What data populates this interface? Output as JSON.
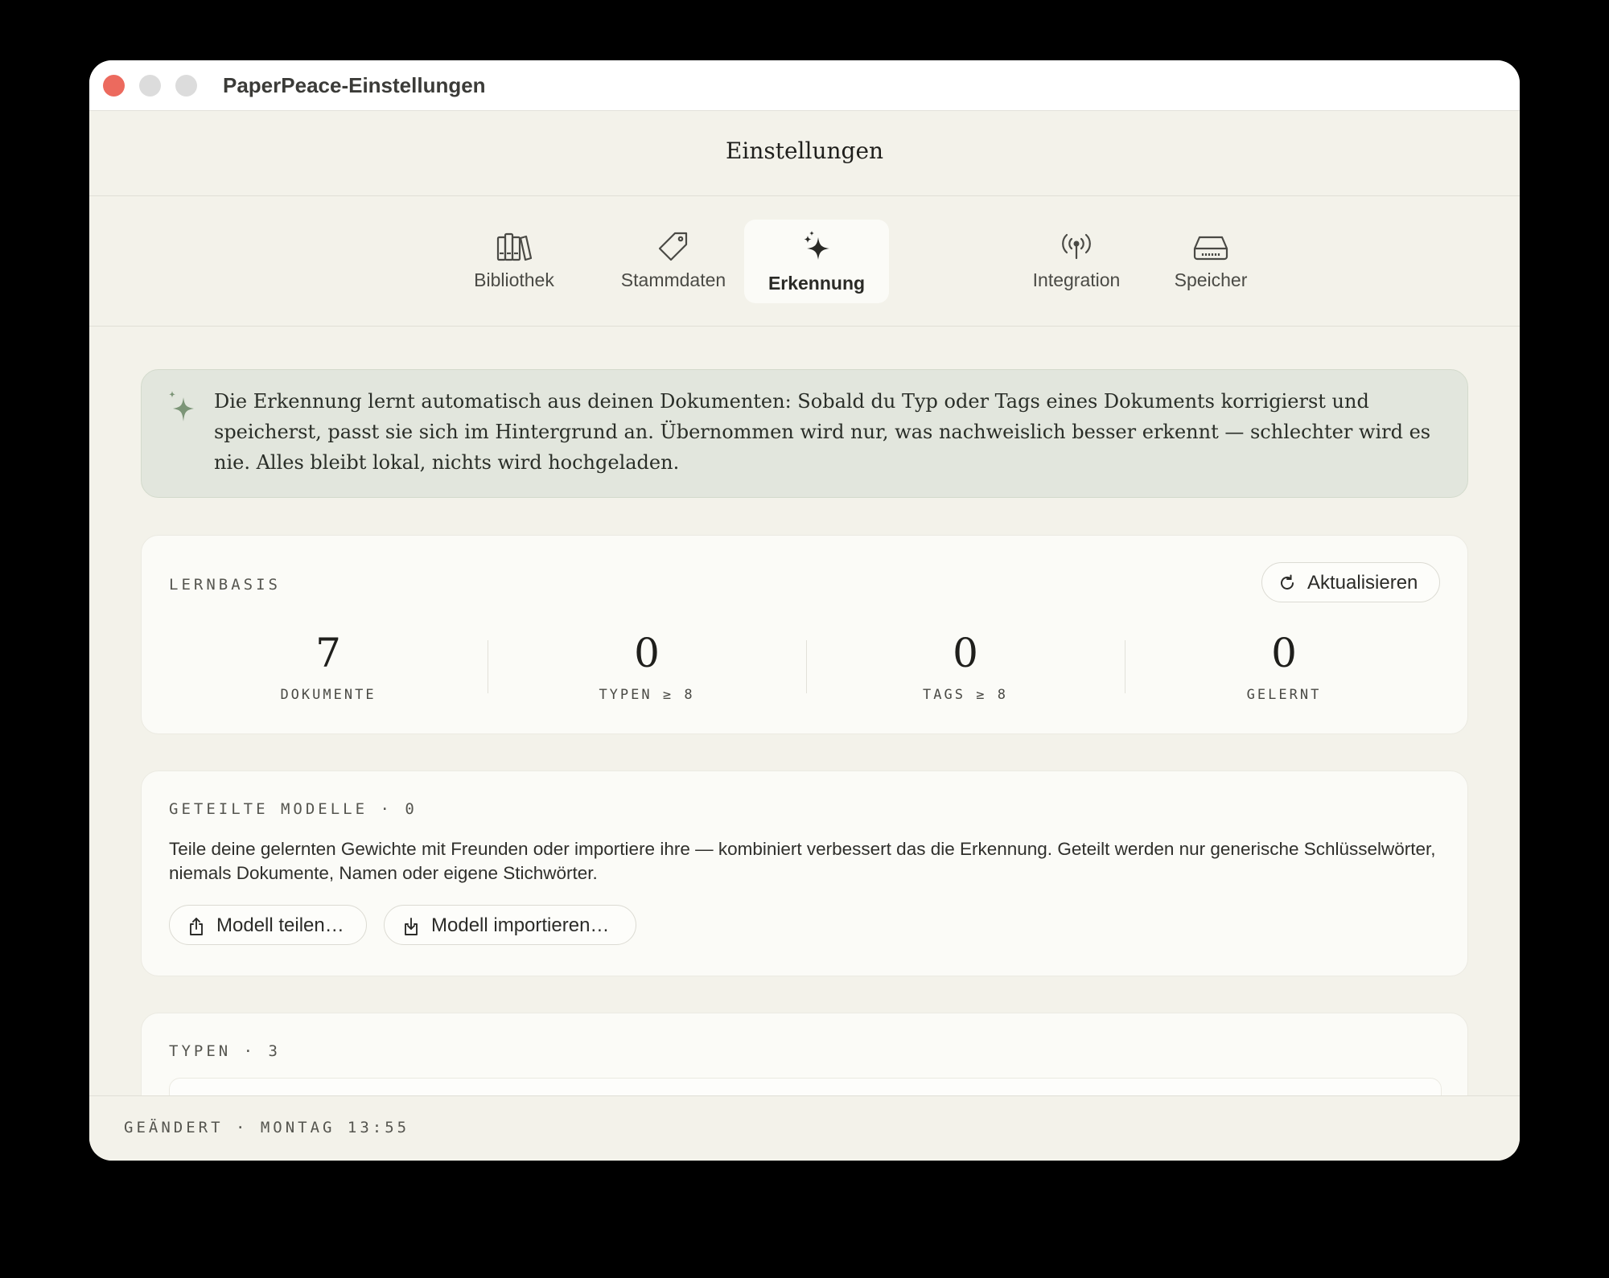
{
  "window": {
    "title": "PaperPeace-Einstellungen"
  },
  "header": {
    "title": "Einstellungen"
  },
  "tabs": [
    {
      "label": "Bibliothek",
      "icon": "books-icon"
    },
    {
      "label": "Stammdaten",
      "icon": "tag-icon"
    },
    {
      "label": "Erkennung",
      "icon": "sparkles-icon",
      "active": true
    },
    {
      "label": "Integration",
      "icon": "antenna-icon"
    },
    {
      "label": "Speicher",
      "icon": "drive-icon"
    }
  ],
  "info": {
    "icon": "sparkles-icon",
    "text": "Die Erkennung lernt automatisch aus deinen Dokumenten: Sobald du Typ oder Tags eines Dokuments korrigierst und speicherst, passt sie sich im Hintergrund an. Übernommen wird nur, was nachweislich besser erkennt — schlechter wird es nie. Alles bleibt lokal, nichts wird hochgeladen."
  },
  "lernbasis": {
    "label": "LERNBASIS",
    "refresh_label": "Aktualisieren",
    "stats": [
      {
        "value": "7",
        "caption": "DOKUMENTE"
      },
      {
        "value": "0",
        "caption": "TYPEN ≥ 8"
      },
      {
        "value": "0",
        "caption": "TAGS ≥ 8"
      },
      {
        "value": "0",
        "caption": "GELERNT"
      }
    ]
  },
  "shared": {
    "label": "GETEILTE MODELLE · 0",
    "description": "Teile deine gelernten Gewichte mit Freunden oder importiere ihre — kombiniert verbessert das die Erkennung. Geteilt werden nur generische Schlüsselwörter, niemals Dokumente, Namen oder eigene Stichwörter.",
    "share_label": "Modell teilen…",
    "import_label": "Modell importieren…"
  },
  "types": {
    "label": "TYPEN · 3"
  },
  "footer": {
    "text": "GEÄNDERT · MONTAG 13:55"
  },
  "colors": {
    "accent_green": "#6f8c6a",
    "close_red": "#ec6a5e",
    "info_bg": "#e2e6dd"
  }
}
